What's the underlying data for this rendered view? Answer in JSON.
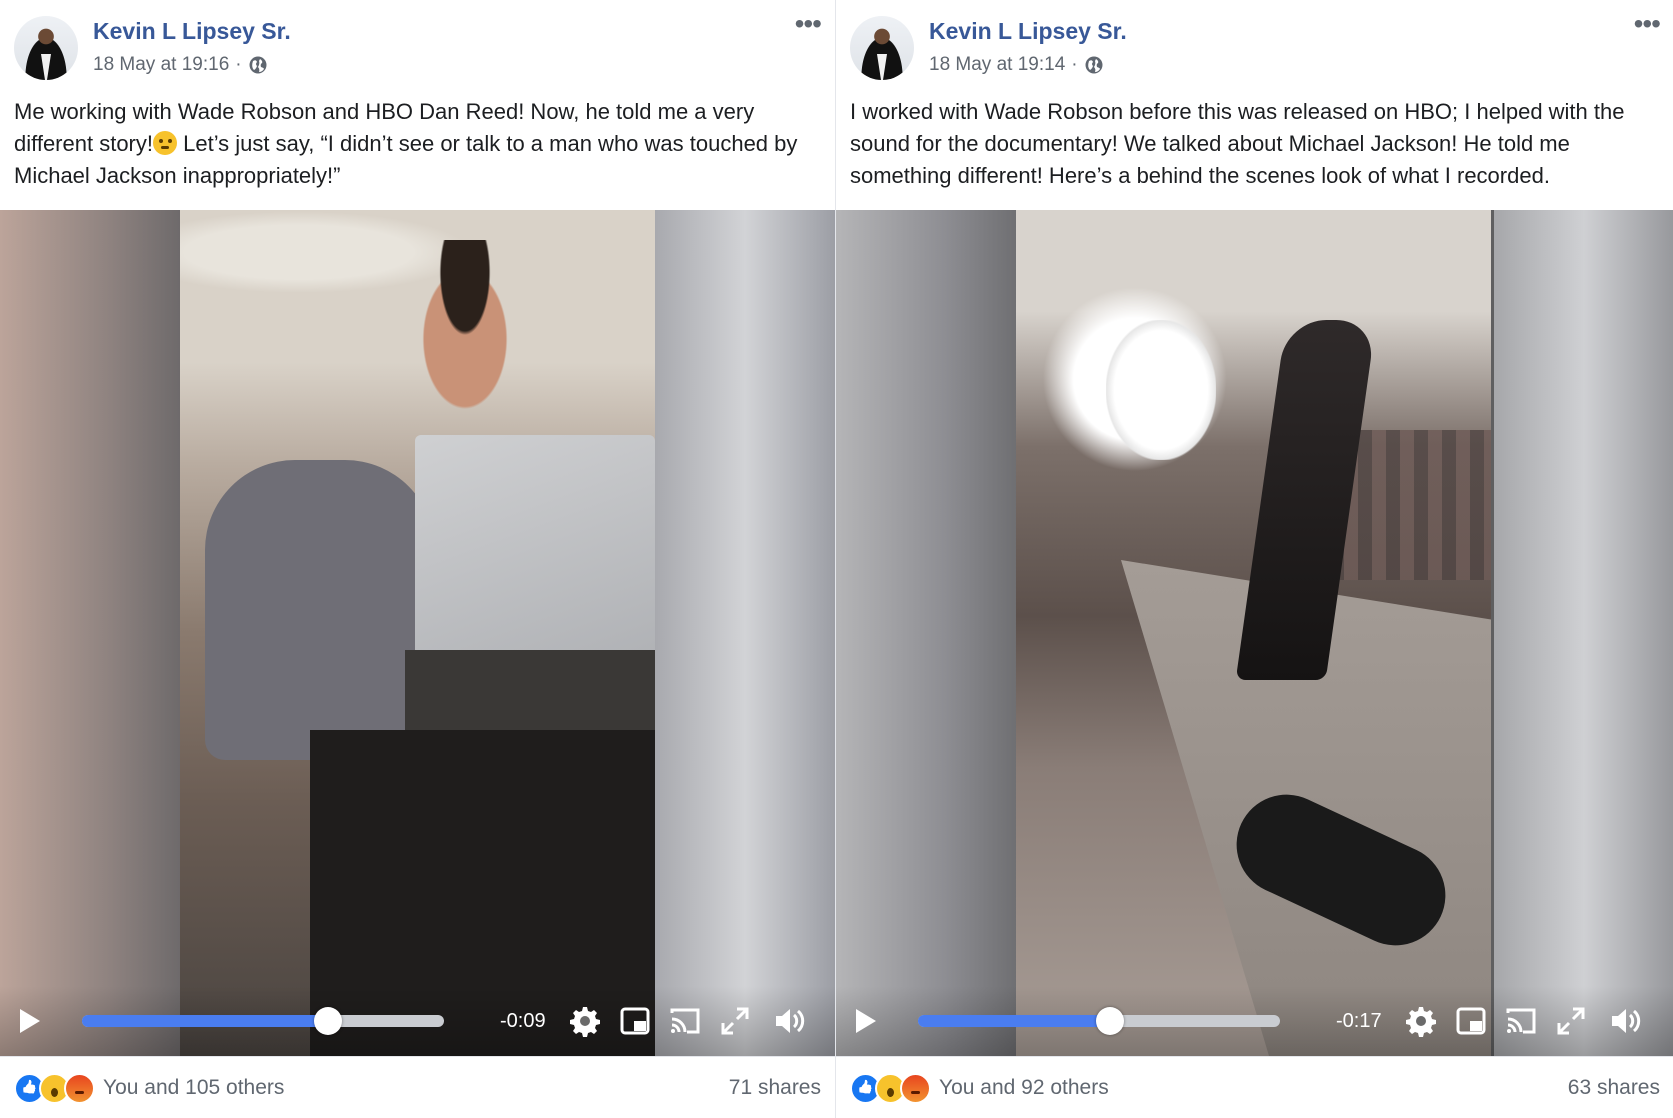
{
  "posts": [
    {
      "author": "Kevin L Lipsey Sr.",
      "timestamp": "18 May at 19:16",
      "text_before_emoji": "Me working with Wade Robson and HBO Dan Reed! Now, he told me a very different story!",
      "text_after_emoji": " Let’s just say, “I didn’t see or talk to a man who was touched by Michael Jackson inappropriately!”",
      "video": {
        "time_remaining": "-0:09",
        "progress": 0.68
      },
      "reactions_label": "You and 105 others",
      "shares_label": "71 shares"
    },
    {
      "author": "Kevin L Lipsey Sr.",
      "timestamp": "18 May at 19:14",
      "text_before_emoji": "I worked with Wade Robson before this was released on HBO; I helped with the sound for the documentary! We talked about Michael Jackson! He told me something different! Here’s a behind the scenes look of what I recorded.",
      "text_after_emoji": "",
      "video": {
        "time_remaining": "-0:17",
        "progress": 0.53
      },
      "reactions_label": "You and 92 others",
      "shares_label": "63 shares"
    }
  ],
  "meta_separator": " · ",
  "icons": {
    "privacy": "globe-icon",
    "menu": "more-options-icon",
    "controls": [
      "play-icon",
      "settings-gear-icon",
      "picture-in-picture-icon",
      "cast-icon",
      "fullscreen-icon",
      "volume-icon"
    ],
    "reactions": [
      "like-reaction-icon",
      "wow-reaction-icon",
      "angry-reaction-icon"
    ]
  },
  "colors": {
    "author_link": "#385898",
    "progress_fill": "#4a7df0",
    "secondary_text": "#606770"
  }
}
